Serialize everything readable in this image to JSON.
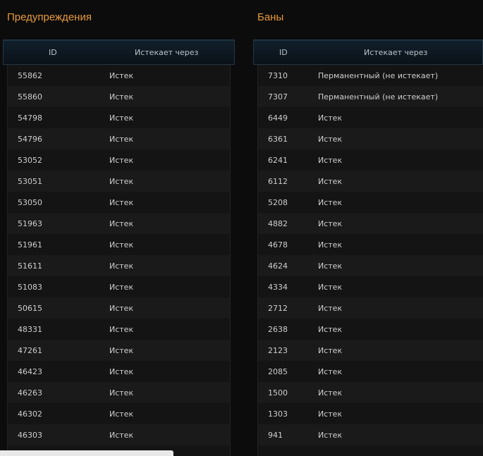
{
  "warnings": {
    "title": "Предупреждения",
    "headers": {
      "id": "ID",
      "expires": "Истекает через"
    },
    "rows": [
      {
        "id": "55862",
        "expires": "Истек"
      },
      {
        "id": "55860",
        "expires": "Истек"
      },
      {
        "id": "54798",
        "expires": "Истек"
      },
      {
        "id": "54796",
        "expires": "Истек"
      },
      {
        "id": "53052",
        "expires": "Истек"
      },
      {
        "id": "53051",
        "expires": "Истек"
      },
      {
        "id": "53050",
        "expires": "Истек"
      },
      {
        "id": "51963",
        "expires": "Истек"
      },
      {
        "id": "51961",
        "expires": "Истек"
      },
      {
        "id": "51611",
        "expires": "Истек"
      },
      {
        "id": "51083",
        "expires": "Истек"
      },
      {
        "id": "50615",
        "expires": "Истек"
      },
      {
        "id": "48331",
        "expires": "Истек"
      },
      {
        "id": "47261",
        "expires": "Истек"
      },
      {
        "id": "46423",
        "expires": "Истек"
      },
      {
        "id": "46263",
        "expires": "Истек"
      },
      {
        "id": "46302",
        "expires": "Истек"
      },
      {
        "id": "46303",
        "expires": "Истек"
      }
    ]
  },
  "bans": {
    "title": "Баны",
    "headers": {
      "id": "ID",
      "expires": "Истекает через"
    },
    "rows": [
      {
        "id": "7310",
        "expires": "Перманентный (не истекает)"
      },
      {
        "id": "7307",
        "expires": "Перманентный (не истекает)"
      },
      {
        "id": "6449",
        "expires": "Истек"
      },
      {
        "id": "6361",
        "expires": "Истек"
      },
      {
        "id": "6241",
        "expires": "Истек"
      },
      {
        "id": "6112",
        "expires": "Истек"
      },
      {
        "id": "5208",
        "expires": "Истек"
      },
      {
        "id": "4882",
        "expires": "Истек"
      },
      {
        "id": "4678",
        "expires": "Истек"
      },
      {
        "id": "4624",
        "expires": "Истек"
      },
      {
        "id": "4334",
        "expires": "Истек"
      },
      {
        "id": "2712",
        "expires": "Истек"
      },
      {
        "id": "2638",
        "expires": "Истек"
      },
      {
        "id": "2123",
        "expires": "Истек"
      },
      {
        "id": "2085",
        "expires": "Истек"
      },
      {
        "id": "1500",
        "expires": "Истек"
      },
      {
        "id": "1303",
        "expires": "Истек"
      },
      {
        "id": "941",
        "expires": "Истек"
      }
    ]
  },
  "colors": {
    "title": "#e79a3a",
    "header_bg": "#0d1720",
    "row_even": "#1a1a1a",
    "row_odd": "#141414",
    "text": "#cfcfcf"
  }
}
